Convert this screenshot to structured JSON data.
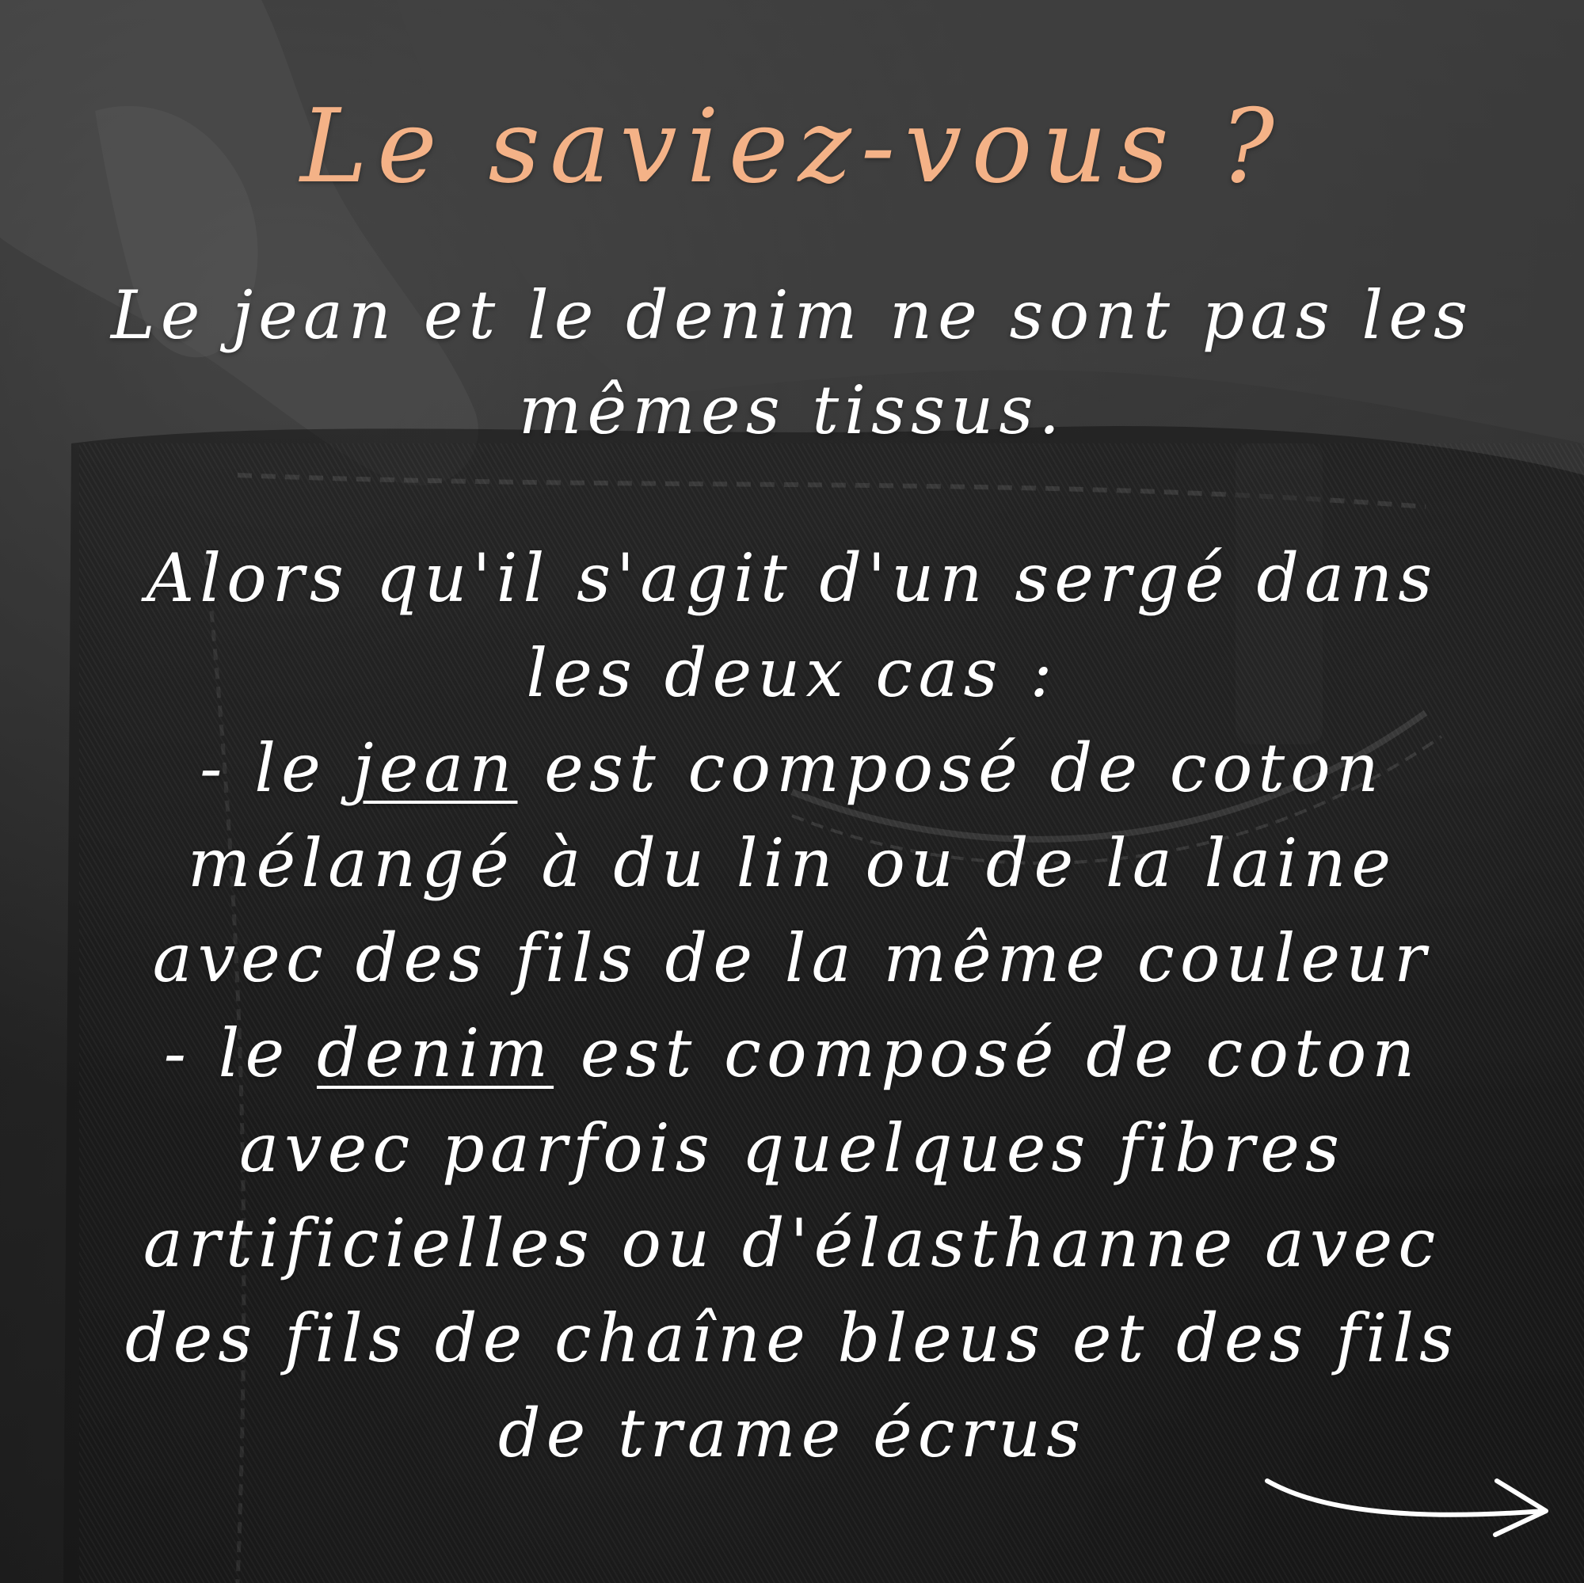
{
  "title": "Le saviez-vous ?",
  "intro_lines": [
    "Le jean et le denim ne sont pas les",
    "mêmes tissus."
  ],
  "detail": {
    "line1": "Alors qu'il s'agit d'un sergé dans",
    "line2": "les deux cas :",
    "jean_prefix": "- le ",
    "jean_word": "jean",
    "jean_suffix": " est composé de coton",
    "jean_line2": "mélangé à du lin ou de la laine",
    "jean_line3": "avec des fils de la même couleur",
    "denim_prefix": "- le ",
    "denim_word": "denim",
    "denim_suffix": " est composé de coton",
    "denim_line2": "avec parfois quelques fibres",
    "denim_line3": "artificielles ou d'élasthanne avec",
    "denim_line4": "des fils de chaîne bleus et des fils",
    "denim_line5": "de trame écrus"
  },
  "colors": {
    "title": "#f4b287",
    "text": "#ffffff"
  },
  "icons": {
    "next": "arrow-right-icon"
  }
}
